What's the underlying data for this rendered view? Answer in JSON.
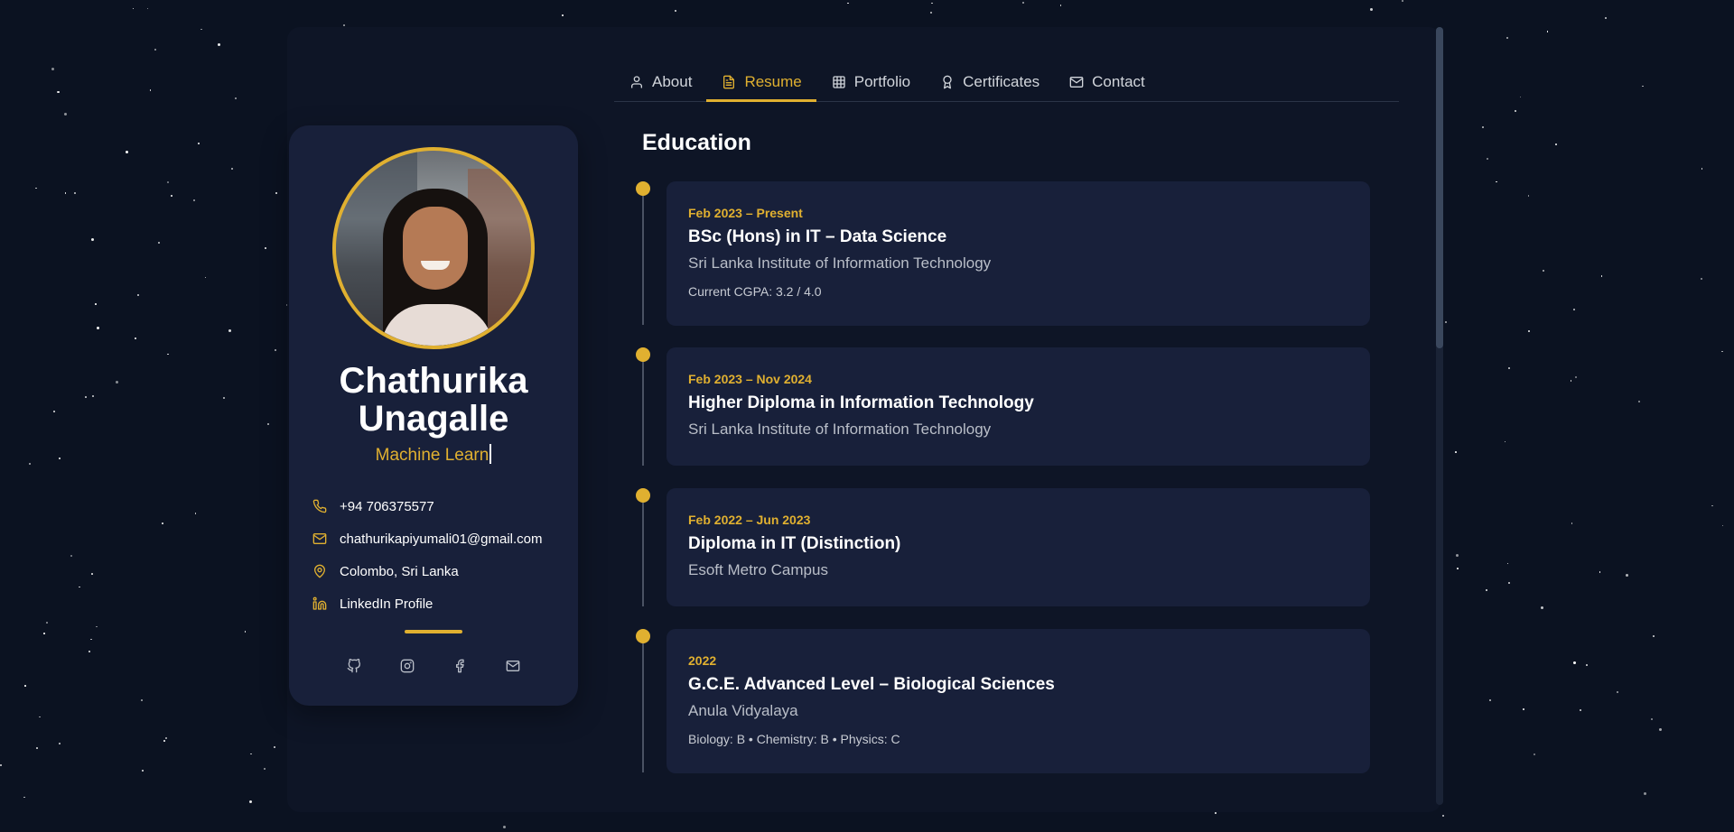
{
  "tabs": [
    {
      "label": "About",
      "icon": "user-icon"
    },
    {
      "label": "Resume",
      "icon": "document-icon",
      "active": true
    },
    {
      "label": "Portfolio",
      "icon": "grid-icon"
    },
    {
      "label": "Certificates",
      "icon": "award-icon"
    },
    {
      "label": "Contact",
      "icon": "mail-icon"
    }
  ],
  "profile": {
    "name": "Chathurika Unagalle",
    "role_typed": "Machine Learn",
    "contacts": {
      "phone": "+94 706375577",
      "email": "chathurikapiyumali01@gmail.com",
      "location": "Colombo, Sri Lanka",
      "linkedin": "LinkedIn Profile"
    },
    "socials": [
      "github-icon",
      "instagram-icon",
      "facebook-icon",
      "mail-icon"
    ]
  },
  "education": {
    "title": "Education",
    "items": [
      {
        "date": "Feb 2023 – Present",
        "degree": "BSc (Hons) in IT – Data Science",
        "institution": "Sri Lanka Institute of Information Technology",
        "note": "Current CGPA: 3.2 / 4.0"
      },
      {
        "date": "Feb 2023 – Nov 2024",
        "degree": "Higher Diploma in Information Technology",
        "institution": "Sri Lanka Institute of Information Technology",
        "note": ""
      },
      {
        "date": "Feb 2022 – Jun 2023",
        "degree": "Diploma in IT (Distinction)",
        "institution": "Esoft Metro Campus",
        "note": ""
      },
      {
        "date": "2022",
        "degree": "G.C.E. Advanced Level – Biological Sciences",
        "institution": "Anula Vidyalaya",
        "note": "Biology: B • Chemistry: B • Physics: C"
      }
    ]
  },
  "colors": {
    "accent": "#e0b030",
    "background": "#0b1221",
    "card": "#18203a"
  }
}
